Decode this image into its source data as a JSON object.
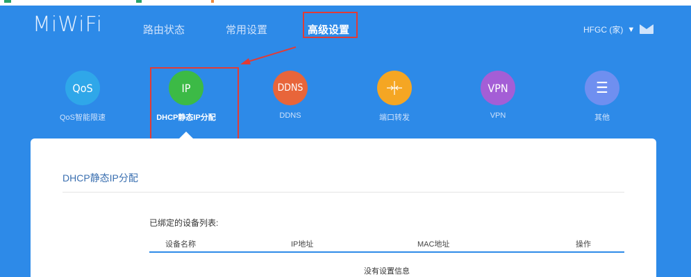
{
  "logo": "MiWiFi",
  "nav": {
    "items": [
      {
        "label": "路由状态"
      },
      {
        "label": "常用设置"
      },
      {
        "label": "高级设置"
      }
    ]
  },
  "user": {
    "name": "HFGC (家)"
  },
  "features": [
    {
      "icon_text": "QoS",
      "label": "QoS智能限速",
      "color": "#2fa7e9"
    },
    {
      "icon_text": "IP",
      "label": "DHCP静态IP分配",
      "color": "#3cba46"
    },
    {
      "icon_text": "DDNS",
      "label": "DDNS",
      "color": "#e8653a"
    },
    {
      "icon_text": "",
      "label": "端口转发",
      "color": "#f5a623"
    },
    {
      "icon_text": "VPN",
      "label": "VPN",
      "color": "#a45ed6"
    },
    {
      "icon_text": "☰",
      "label": "其他",
      "color": "#6f8ff0"
    }
  ],
  "panel": {
    "title": "DHCP静态IP分配",
    "list_caption": "已绑定的设备列表:",
    "columns": [
      "设备名称",
      "IP地址",
      "MAC地址",
      "操作"
    ],
    "empty_text": "没有设置信息"
  },
  "colors": {
    "background": "#2d8ae8",
    "annotation": "#e23b35"
  }
}
